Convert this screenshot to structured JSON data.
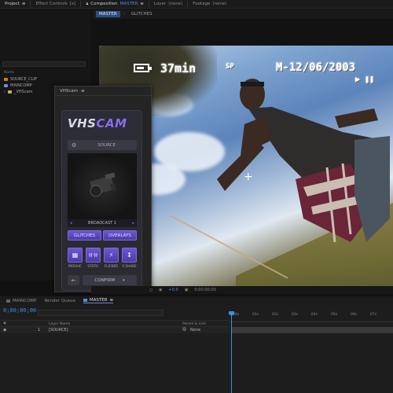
{
  "top_tabs": [
    {
      "label": "Project",
      "active": true
    },
    {
      "label": "Effect Controls",
      "suffix": "[x]",
      "active": false
    },
    {
      "label": "Composition",
      "accent": "MASTER",
      "active": true
    },
    {
      "label": "Layer",
      "suffix": "(none)",
      "active": false
    },
    {
      "label": "Footage",
      "suffix": "(none)",
      "active": false
    }
  ],
  "comp_subtabs": [
    "MASTER",
    "GLITCHES"
  ],
  "project": {
    "header": "Name",
    "items": [
      {
        "label": "SOURCE_CLIP",
        "color": "#d07a2a"
      },
      {
        "label": "MAINCOMP",
        "color": "#6b8fd8"
      },
      {
        "label": "_VHScam",
        "color": "#c8b24a"
      }
    ]
  },
  "osd": {
    "battery_time": "37min",
    "mode": "SP",
    "date": "M-12/06/2003",
    "controls": "▶ ❚❚"
  },
  "plugin": {
    "window_title": "VHScam",
    "logo_part1": "VHS",
    "logo_part2": "CAM",
    "source_button": "SOURCE",
    "preset_name": "BROADCAST 1",
    "glitches_button": "GLITCHES",
    "overlays_button": "OVERLAYS",
    "effects": [
      {
        "label": "MOSAIC",
        "icon": "grid-icon",
        "glyph": "▦"
      },
      {
        "label": "STATIC",
        "icon": "signal-icon",
        "glyph": "((·))"
      },
      {
        "label": "FLICKER",
        "icon": "flash-icon",
        "glyph": "⚡"
      },
      {
        "label": "V SHAKE",
        "icon": "shake-icon",
        "glyph": "↕"
      }
    ],
    "confirm_button": "CONFIRM",
    "accent_color": "#6c56d3"
  },
  "viewer_footer": {
    "zoom": "+0.0",
    "timecode": "0;00;00;00"
  },
  "timeline": {
    "tabs": [
      {
        "label": "MAINCOMP",
        "active": false
      },
      {
        "label": "Render Queue",
        "active": false
      },
      {
        "label": "MASTER",
        "active": true
      }
    ],
    "current_time": "0;00;00;00",
    "columns": {
      "layer_name": "Layer Name",
      "parent": "Parent & Link"
    },
    "layer": {
      "index": "1",
      "name": "[SOURCE]",
      "parent": "None"
    },
    "ticks": [
      "00s",
      "01s",
      "02s",
      "03s",
      "04s",
      "05s",
      "06s",
      "07s"
    ]
  }
}
